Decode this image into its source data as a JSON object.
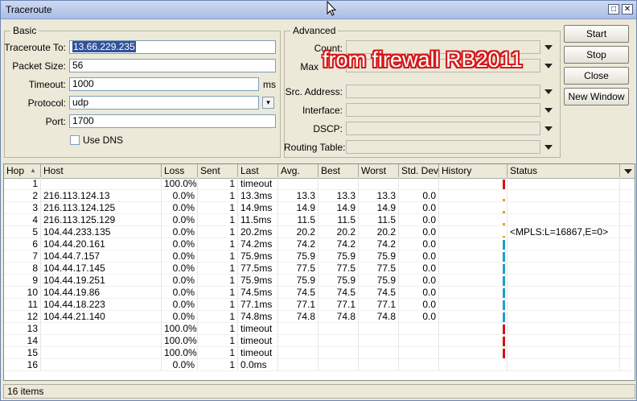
{
  "window": {
    "title": "Traceroute",
    "restore_glyph": "□",
    "close_glyph": "✕"
  },
  "overlay_text": "from firewall RB2011",
  "basic": {
    "title": "Basic",
    "traceroute_to_label": "Traceroute To:",
    "traceroute_to_value": "13.66.229.235",
    "packet_size_label": "Packet Size:",
    "packet_size_value": "56",
    "timeout_label": "Timeout:",
    "timeout_value": "1000",
    "timeout_unit": "ms",
    "protocol_label": "Protocol:",
    "protocol_value": "udp",
    "port_label": "Port:",
    "port_value": "1700",
    "use_dns_label": "Use DNS",
    "use_dns_checked": false
  },
  "advanced": {
    "title": "Advanced",
    "count_label": "Count:",
    "max_label": "Max",
    "src_address_label": "Src. Address:",
    "interface_label": "Interface:",
    "dscp_label": "DSCP:",
    "routing_table_label": "Routing Table:"
  },
  "buttons": {
    "start": "Start",
    "stop": "Stop",
    "close": "Close",
    "new_window": "New Window"
  },
  "table": {
    "columns": [
      "Hop",
      "Host",
      "Loss",
      "Sent",
      "Last",
      "Avg.",
      "Best",
      "Worst",
      "Std. Dev.",
      "History",
      "Status"
    ],
    "sort_indicator": "▲",
    "rows": [
      {
        "hop": "1",
        "host": "",
        "loss": "100.0%",
        "sent": "1",
        "last": "timeout",
        "avg": "",
        "best": "",
        "worst": "",
        "std": "",
        "status": "",
        "history_color": "#d81010"
      },
      {
        "hop": "2",
        "host": "216.113.124.13",
        "loss": "0.0%",
        "sent": "1",
        "last": "13.3ms",
        "avg": "13.3",
        "best": "13.3",
        "worst": "13.3",
        "std": "0.0",
        "status": "",
        "history_color": "#e0a020"
      },
      {
        "hop": "3",
        "host": "216.113.124.125",
        "loss": "0.0%",
        "sent": "1",
        "last": "14.9ms",
        "avg": "14.9",
        "best": "14.9",
        "worst": "14.9",
        "std": "0.0",
        "status": "",
        "history_color": "#e0a020"
      },
      {
        "hop": "4",
        "host": "216.113.125.129",
        "loss": "0.0%",
        "sent": "1",
        "last": "11.5ms",
        "avg": "11.5",
        "best": "11.5",
        "worst": "11.5",
        "std": "0.0",
        "status": "",
        "history_color": "#e0a020"
      },
      {
        "hop": "5",
        "host": "104.44.233.135",
        "loss": "0.0%",
        "sent": "1",
        "last": "20.2ms",
        "avg": "20.2",
        "best": "20.2",
        "worst": "20.2",
        "std": "0.0",
        "status": "<MPLS:L=16867,E=0>",
        "history_color": "#e0a020"
      },
      {
        "hop": "6",
        "host": "104.44.20.161",
        "loss": "0.0%",
        "sent": "1",
        "last": "74.2ms",
        "avg": "74.2",
        "best": "74.2",
        "worst": "74.2",
        "std": "0.0",
        "status": "",
        "history_color": "#1aa0c8"
      },
      {
        "hop": "7",
        "host": "104.44.7.157",
        "loss": "0.0%",
        "sent": "1",
        "last": "75.9ms",
        "avg": "75.9",
        "best": "75.9",
        "worst": "75.9",
        "std": "0.0",
        "status": "",
        "history_color": "#1aa0c8"
      },
      {
        "hop": "8",
        "host": "104.44.17.145",
        "loss": "0.0%",
        "sent": "1",
        "last": "77.5ms",
        "avg": "77.5",
        "best": "77.5",
        "worst": "77.5",
        "std": "0.0",
        "status": "",
        "history_color": "#1aa0c8"
      },
      {
        "hop": "9",
        "host": "104.44.19.251",
        "loss": "0.0%",
        "sent": "1",
        "last": "75.9ms",
        "avg": "75.9",
        "best": "75.9",
        "worst": "75.9",
        "std": "0.0",
        "status": "",
        "history_color": "#1aa0c8"
      },
      {
        "hop": "10",
        "host": "104.44.19.86",
        "loss": "0.0%",
        "sent": "1",
        "last": "74.5ms",
        "avg": "74.5",
        "best": "74.5",
        "worst": "74.5",
        "std": "0.0",
        "status": "",
        "history_color": "#1aa0c8"
      },
      {
        "hop": "11",
        "host": "104.44.18.223",
        "loss": "0.0%",
        "sent": "1",
        "last": "77.1ms",
        "avg": "77.1",
        "best": "77.1",
        "worst": "77.1",
        "std": "0.0",
        "status": "",
        "history_color": "#1aa0c8"
      },
      {
        "hop": "12",
        "host": "104.44.21.140",
        "loss": "0.0%",
        "sent": "1",
        "last": "74.8ms",
        "avg": "74.8",
        "best": "74.8",
        "worst": "74.8",
        "std": "0.0",
        "status": "",
        "history_color": "#1aa0c8"
      },
      {
        "hop": "13",
        "host": "",
        "loss": "100.0%",
        "sent": "1",
        "last": "timeout",
        "avg": "",
        "best": "",
        "worst": "",
        "std": "",
        "status": "",
        "history_color": "#d81010"
      },
      {
        "hop": "14",
        "host": "",
        "loss": "100.0%",
        "sent": "1",
        "last": "timeout",
        "avg": "",
        "best": "",
        "worst": "",
        "std": "",
        "status": "",
        "history_color": "#d81010"
      },
      {
        "hop": "15",
        "host": "",
        "loss": "100.0%",
        "sent": "1",
        "last": "timeout",
        "avg": "",
        "best": "",
        "worst": "",
        "std": "",
        "status": "",
        "history_color": "#d81010"
      },
      {
        "hop": "16",
        "host": "",
        "loss": "0.0%",
        "sent": "1",
        "last": "0.0ms",
        "avg": "",
        "best": "",
        "worst": "",
        "std": "",
        "status": "",
        "history_color": ""
      }
    ]
  },
  "status_bar": {
    "items": "16 items"
  }
}
